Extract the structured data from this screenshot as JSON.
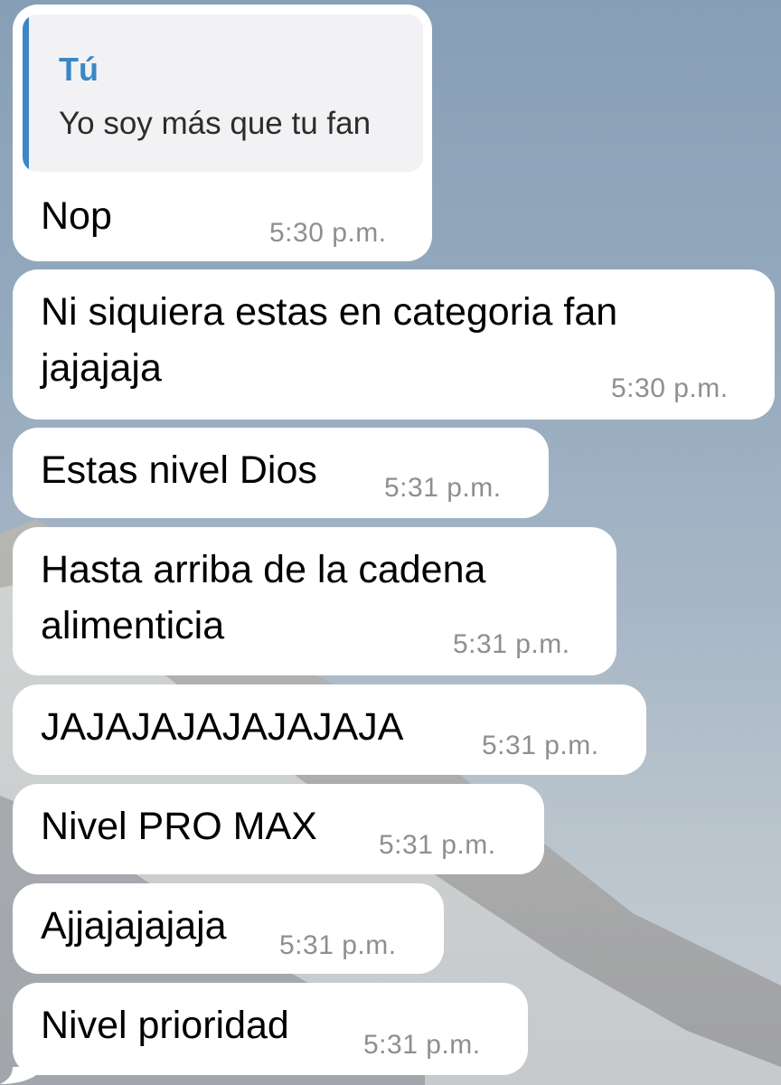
{
  "reply_quote": {
    "author": "Tú",
    "text": "Yo soy más que tu fan"
  },
  "messages": [
    {
      "lines": [
        "Nop"
      ],
      "time": "5:30 p.m."
    },
    {
      "lines": [
        "Ni siquiera estas en categoria fan",
        "jajajaja"
      ],
      "time": "5:30 p.m."
    },
    {
      "lines": [
        "Estas nivel Dios"
      ],
      "time": "5:31 p.m."
    },
    {
      "lines": [
        "Hasta arriba de la cadena",
        "alimenticia"
      ],
      "time": "5:31 p.m."
    },
    {
      "lines": [
        "JAJAJAJAJAJAJAJA"
      ],
      "time": "5:31 p.m."
    },
    {
      "lines": [
        "Nivel PRO MAX"
      ],
      "time": "5:31 p.m."
    },
    {
      "lines": [
        "Ajjajajajaja"
      ],
      "time": "5:31 p.m."
    },
    {
      "lines": [
        "Nivel prioridad"
      ],
      "time": "5:31 p.m."
    }
  ],
  "colors": {
    "bubble": "#ffffff",
    "reply_accent": "#3a87c7",
    "timestamp": "#8e8e93"
  }
}
